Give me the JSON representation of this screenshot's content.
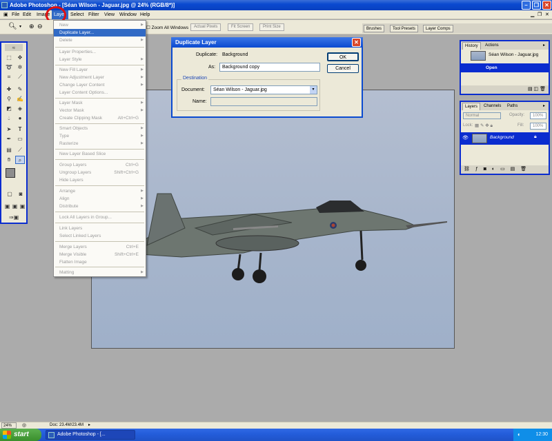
{
  "app": {
    "title": "Adobe Photoshop - [Séan Wilson - Jaguar.jpg @ 24% (RGB/8*)]"
  },
  "menubar": [
    "File",
    "Edit",
    "Image",
    "Layer",
    "Select",
    "Filter",
    "View",
    "Window",
    "Help"
  ],
  "options": {
    "zoom_all_windows": "Zoom All Windows",
    "actual_pixels": "Actual Pixels",
    "fit_screen": "Fit Screen",
    "print_size": "Print Size"
  },
  "palette_well": [
    "Brushes",
    "Tool Presets",
    "Layer Comps"
  ],
  "layer_menu": {
    "items": [
      {
        "label": "New",
        "shortcut": "",
        "arrow": true
      },
      {
        "label": "Duplicate Layer...",
        "shortcut": "",
        "arrow": false
      },
      {
        "label": "Delete",
        "shortcut": "",
        "arrow": true
      },
      {
        "label": "Layer Properties...",
        "shortcut": "",
        "arrow": false
      },
      {
        "label": "Layer Style",
        "shortcut": "",
        "arrow": true
      },
      {
        "label": "New Fill Layer",
        "shortcut": "",
        "arrow": true
      },
      {
        "label": "New Adjustment Layer",
        "shortcut": "",
        "arrow": true
      },
      {
        "label": "Change Layer Content",
        "shortcut": "",
        "arrow": true
      },
      {
        "label": "Layer Content Options...",
        "shortcut": "",
        "arrow": false
      },
      {
        "label": "Layer Mask",
        "shortcut": "",
        "arrow": true
      },
      {
        "label": "Vector Mask",
        "shortcut": "",
        "arrow": true
      },
      {
        "label": "Create Clipping Mask",
        "shortcut": "Alt+Ctrl+G",
        "arrow": false
      },
      {
        "label": "Smart Objects",
        "shortcut": "",
        "arrow": true
      },
      {
        "label": "Type",
        "shortcut": "",
        "arrow": true
      },
      {
        "label": "Rasterize",
        "shortcut": "",
        "arrow": true
      },
      {
        "label": "New Layer Based Slice",
        "shortcut": "",
        "arrow": false
      },
      {
        "label": "Group Layers",
        "shortcut": "Ctrl+G",
        "arrow": false
      },
      {
        "label": "Ungroup Layers",
        "shortcut": "Shift+Ctrl+G",
        "arrow": false
      },
      {
        "label": "Hide Layers",
        "shortcut": "",
        "arrow": false
      },
      {
        "label": "Arrange",
        "shortcut": "",
        "arrow": true
      },
      {
        "label": "Align",
        "shortcut": "",
        "arrow": true
      },
      {
        "label": "Distribute",
        "shortcut": "",
        "arrow": true
      },
      {
        "label": "Lock All Layers in Group...",
        "shortcut": "",
        "arrow": false
      },
      {
        "label": "Link Layers",
        "shortcut": "",
        "arrow": false
      },
      {
        "label": "Select Linked Layers",
        "shortcut": "",
        "arrow": false
      },
      {
        "label": "Merge Layers",
        "shortcut": "Ctrl+E",
        "arrow": false
      },
      {
        "label": "Merge Visible",
        "shortcut": "Shift+Ctrl+E",
        "arrow": false
      },
      {
        "label": "Flatten Image",
        "shortcut": "",
        "arrow": false
      },
      {
        "label": "Matting",
        "shortcut": "",
        "arrow": true
      }
    ]
  },
  "dialog": {
    "title": "Duplicate Layer",
    "duplicate_label": "Duplicate:",
    "duplicate_value": "Background",
    "as_label": "As:",
    "as_value": "Background copy",
    "ok": "OK",
    "cancel": "Cancel",
    "destination_legend": "Destination",
    "document_label": "Document:",
    "document_value": "Séan Wilson - Jaguar.jpg",
    "name_label": "Name:",
    "name_value": ""
  },
  "history_panel": {
    "tabs": [
      "History",
      "Actions"
    ],
    "snapshot": "Séan Wilson - Jaguar.jpg",
    "state": "Open"
  },
  "layers_panel": {
    "tabs": [
      "Layers",
      "Channels",
      "Paths"
    ],
    "blend_mode": "Normal",
    "opacity_label": "Opacity:",
    "opacity": "100%",
    "lock_label": "Lock:",
    "fill_label": "Fill:",
    "fill": "100%",
    "layer_name": "Background"
  },
  "status": {
    "zoom": "24%",
    "doc": "Doc: 23.4M/23.4M"
  },
  "taskbar": {
    "start": "start",
    "task": "Adobe Photoshop - [...",
    "clock": "12:30"
  }
}
